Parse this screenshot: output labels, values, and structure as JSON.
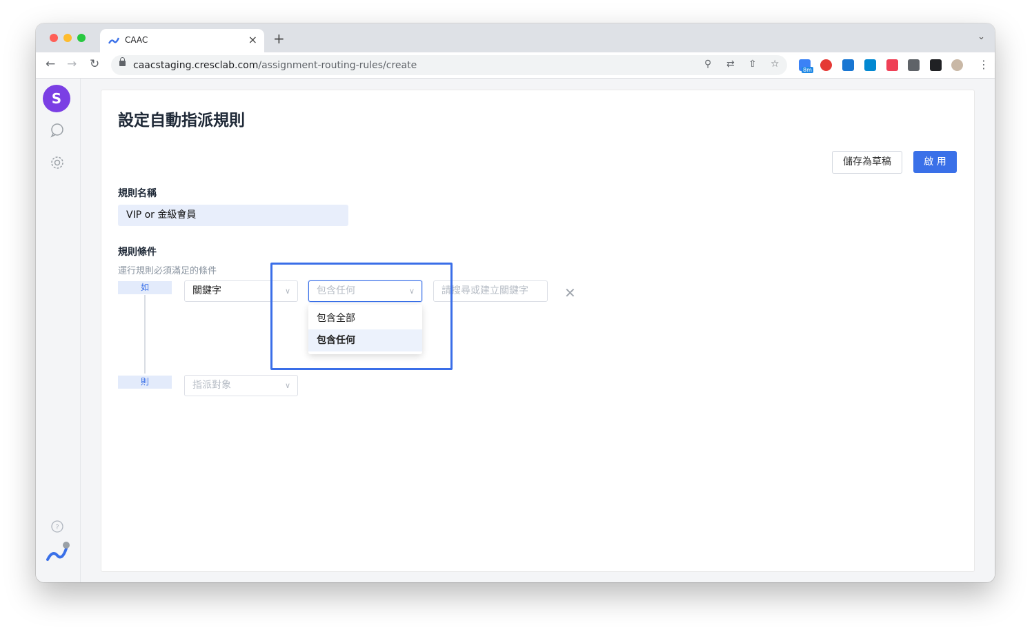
{
  "browser": {
    "tab_title": "CAAC",
    "tab_close": "×",
    "new_tab": "+",
    "url_domain": "caacstaging.cresclab.com",
    "url_path": "/assignment-routing-rules/create",
    "ext_badge": "8m"
  },
  "page": {
    "title": "設定自動指派規則",
    "save_draft_label": "儲存為草稿",
    "enable_label": "啟 用",
    "rule_name_label": "規則名稱",
    "rule_name_value": "VIP or 金級會員",
    "conditions_label": "規則條件",
    "conditions_hint": "運行規則必須滿足的條件",
    "if_tag": "如",
    "then_tag": "則",
    "condition_type_value": "關鍵字",
    "match_mode_placeholder": "包含任何",
    "keyword_placeholder": "請搜尋或建立關鍵字",
    "assign_placeholder": "指派對象",
    "dropdown_options": [
      "包含全部",
      "包含任何"
    ],
    "dropdown_selected": "包含任何"
  },
  "colors": {
    "primary": "#3a70e8",
    "brand_purple": "#7b3fe4",
    "chat_button": "#1e4f9e",
    "annotation_box": "#3a6ee8"
  },
  "icons": [
    "chat-icon",
    "settings-gear-icon",
    "help-icon",
    "chevron-down-icon",
    "close-icon"
  ]
}
